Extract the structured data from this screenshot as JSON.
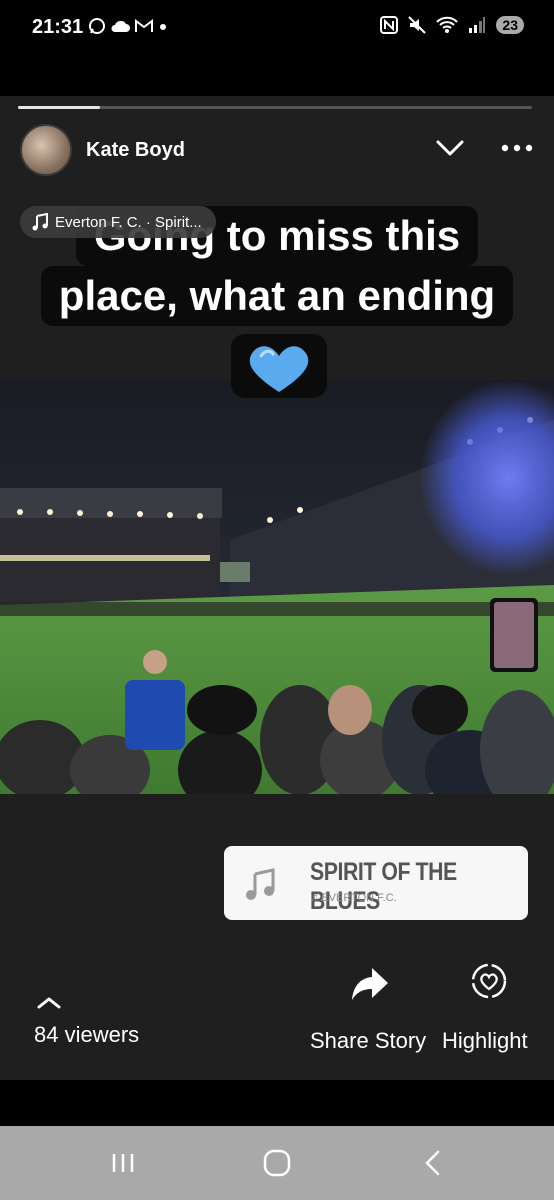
{
  "status": {
    "time": "21:31",
    "battery": "23"
  },
  "story": {
    "progress": 0.16,
    "user": "Kate Boyd",
    "music_chip": "Everton F. C. · Spirit...",
    "caption_lines": [
      "Going to miss this",
      "place, what an ending"
    ],
    "song": {
      "title": "SPIRIT OF THE BLUES",
      "artist": "EVERTON F.C."
    },
    "viewers_label": "84 viewers",
    "share_label": "Share Story",
    "highlight_label": "Highlight"
  },
  "colors": {
    "heart": "#5aaaf0",
    "smoke": "#4a5cd8",
    "pitch": "#4f8a3a"
  }
}
